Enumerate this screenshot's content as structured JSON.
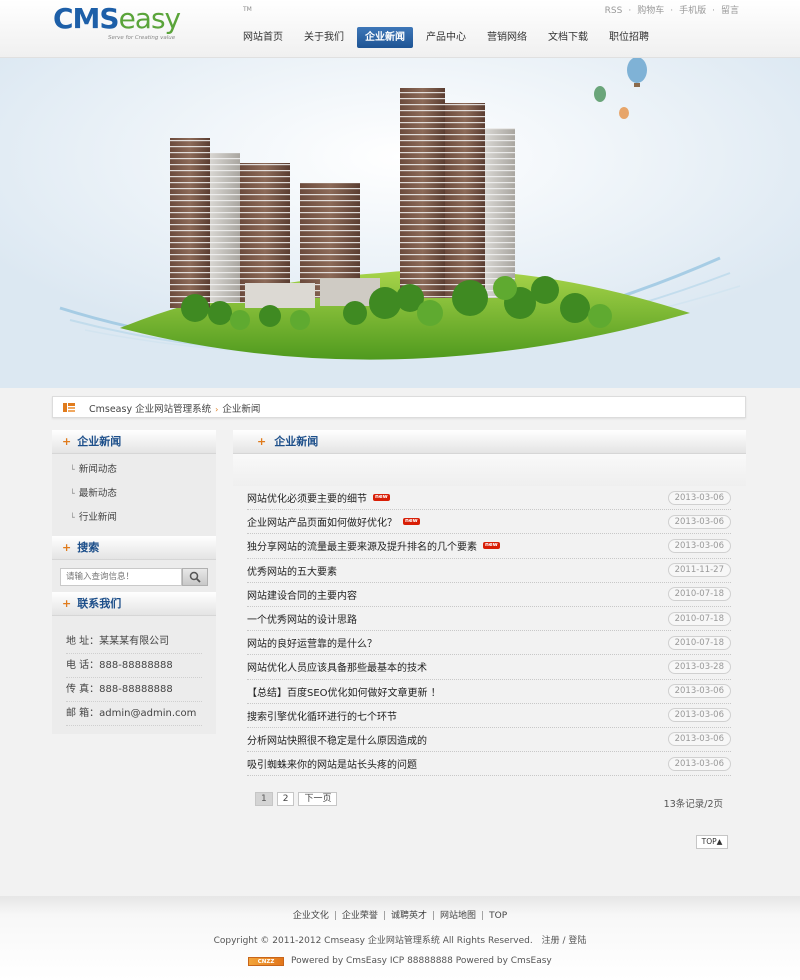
{
  "header": {
    "logo": {
      "part1": "CMS",
      "part2": "easy",
      "tm": "TM",
      "tagline": "Serve for Creating value"
    },
    "top_links": [
      "RSS",
      "购物车",
      "手机版",
      "留言"
    ],
    "top_sep": "·",
    "nav": [
      "网站首页",
      "关于我们",
      "企业新闻",
      "产品中心",
      "营销网络",
      "文档下载",
      "职位招聘"
    ],
    "nav_active": 2
  },
  "breadcrumb": {
    "home": "Cmseasy 企业网站管理系统",
    "sep": "›",
    "current": "企业新闻"
  },
  "sidebar": {
    "category_title": "企业新闻",
    "categories": [
      "新闻动态",
      "最新动态",
      "行业新闻"
    ],
    "search_title": "搜索",
    "search_placeholder": "请输入查询信息！",
    "contact_title": "联系我们",
    "contact": [
      "地 址：某某某有限公司",
      "电 话：888-88888888",
      "传 真：888-88888888",
      "邮 箱：admin@admin.com"
    ]
  },
  "content": {
    "title": "企业新闻",
    "new_badge": "new",
    "news": [
      {
        "title": "网站优化必须要主要的细节",
        "date": "2013-03-06",
        "is_new": true
      },
      {
        "title": "企业网站产品页面如何做好优化？",
        "date": "2013-03-06",
        "is_new": true
      },
      {
        "title": "独分享网站的流量最主要来源及提升排名的几个要素",
        "date": "2013-03-06",
        "is_new": true
      },
      {
        "title": "优秀网站的五大要素",
        "date": "2011-11-27",
        "is_new": false
      },
      {
        "title": "网站建设合同的主要内容",
        "date": "2010-07-18",
        "is_new": false
      },
      {
        "title": "一个优秀网站的设计思路",
        "date": "2010-07-18",
        "is_new": false
      },
      {
        "title": "网站的良好运营靠的是什么？",
        "date": "2010-07-18",
        "is_new": false
      },
      {
        "title": "网站优化人员应该具备那些最基本的技术",
        "date": "2013-03-28",
        "is_new": false
      },
      {
        "title": "【总结】百度SEO优化如何做好文章更新 ！",
        "date": "2013-03-06",
        "is_new": false
      },
      {
        "title": "搜索引擎优化循环进行的七个环节",
        "date": "2013-03-06",
        "is_new": false
      },
      {
        "title": "分析网站快照很不稳定是什么原因造成的",
        "date": "2013-03-06",
        "is_new": false
      },
      {
        "title": "吸引蜘蛛来你的网站是站长头疼的问题",
        "date": "2013-03-06",
        "is_new": false
      }
    ],
    "pager": {
      "pages": [
        "1",
        "2"
      ],
      "next": "下一页",
      "info": "13条记录/2页"
    },
    "top_button": "TOP▲"
  },
  "footer": {
    "links": [
      "企业文化",
      "企业荣誉",
      "诚聘英才",
      "网站地图",
      "TOP"
    ],
    "link_sep": "|",
    "copyright": "Copyright © 2011-2012 Cmseasy 企业网站管理系统 All Rights Reserved.",
    "register": "注册",
    "slash": "/",
    "login": "登陆",
    "cnzz": "CNZZ",
    "powered": "Powered by CmsEasy  ICP 88888888  Powered by CmsEasy"
  },
  "colors": {
    "brand_blue": "#1d5fa8",
    "accent_orange": "#e07b1c",
    "new_red": "#d81e06"
  }
}
